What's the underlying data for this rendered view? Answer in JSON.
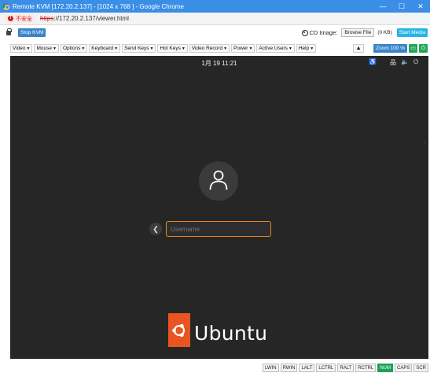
{
  "window": {
    "title": "Remote KVM [172.20.2.137] - [1024 x 768 ] - Google Chrome",
    "minimize": "—",
    "maximize": "☐",
    "close": "✕"
  },
  "address": {
    "security_label": "不安全",
    "url_scheme": "https",
    "url_rest": "://172.20.2.137/viewer.html"
  },
  "kvm": {
    "stop_label": "Stop KVM",
    "cd_image_label": "CD Image:",
    "browse_label": "Browse File",
    "file_size": "(0 KB)",
    "start_media_label": "Start Media"
  },
  "menus": [
    {
      "label": "Video"
    },
    {
      "label": "Mouse"
    },
    {
      "label": "Options"
    },
    {
      "label": "Keyboard"
    },
    {
      "label": "Send Keys"
    },
    {
      "label": "Hot Keys"
    },
    {
      "label": "Video Record"
    },
    {
      "label": "Power"
    },
    {
      "label": "Active Users"
    },
    {
      "label": "Help"
    }
  ],
  "tools": {
    "warning_icon": "▲",
    "zoom_label": "Zoom 100 %",
    "chat_icon": "▭",
    "power_icon": "⏻"
  },
  "remote": {
    "clock": "1月 19  11:21",
    "accessibility_icon": "♿",
    "network_icon": "品",
    "volume_icon": "🔈",
    "power_icon": "⏻",
    "back_icon": "❮",
    "username_placeholder": "Username",
    "logo_text": "Ubuntu"
  },
  "status_keys": [
    {
      "label": "LWIN",
      "active": false
    },
    {
      "label": "RWIN",
      "active": false
    },
    {
      "label": "LALT",
      "active": false
    },
    {
      "label": "LCTRL",
      "active": false
    },
    {
      "label": "RALT",
      "active": false
    },
    {
      "label": "RCTRL",
      "active": false
    },
    {
      "label": "NUM",
      "active": true
    },
    {
      "label": "CAPS",
      "active": false
    },
    {
      "label": "SCR",
      "active": false
    }
  ],
  "colors": {
    "ubuntu_orange": "#e95420",
    "input_focus": "#e9831d",
    "active_key": "#1fa05a",
    "title_bar": "#3a8ee6"
  }
}
